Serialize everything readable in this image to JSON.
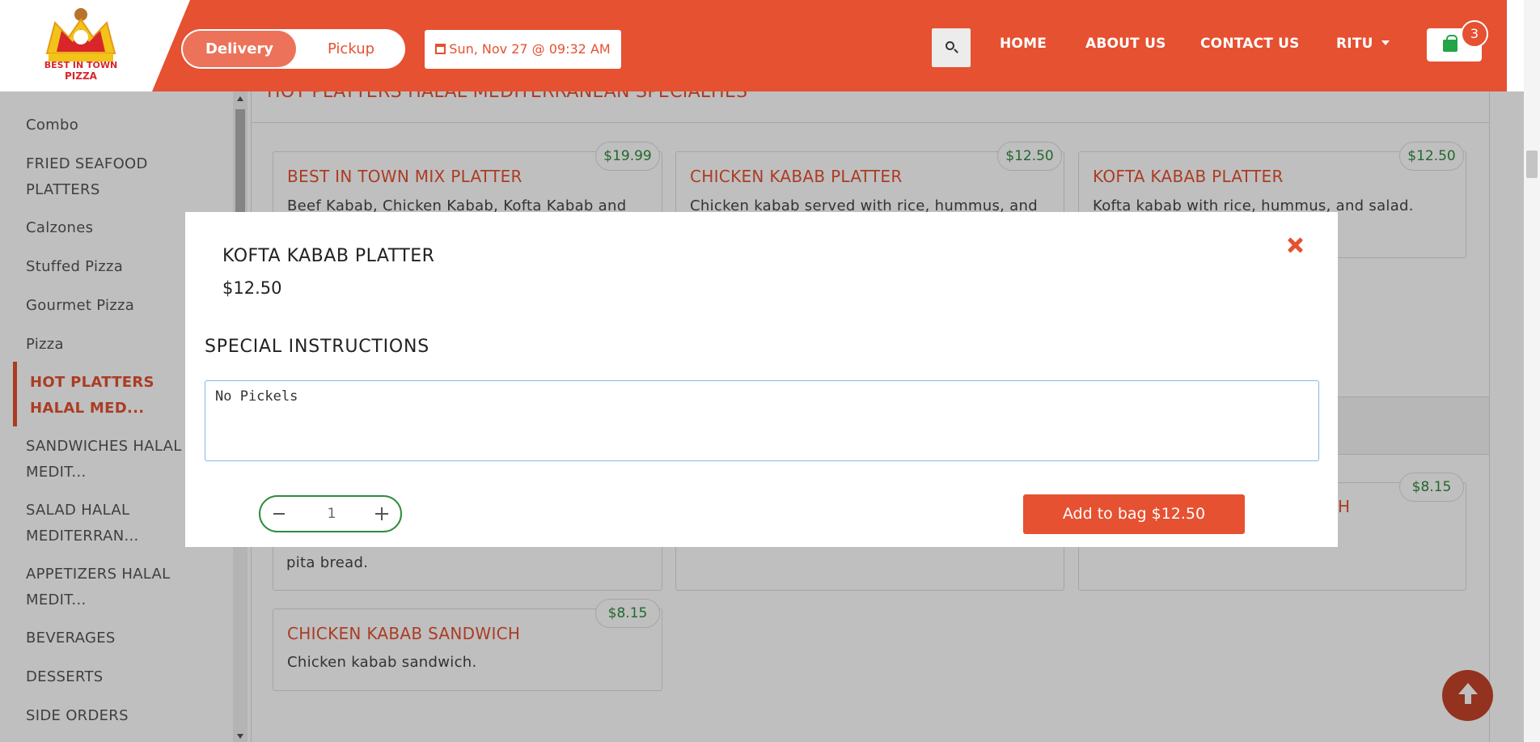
{
  "header": {
    "logo_text": "BEST IN TOWN PIZZA",
    "order_mode": {
      "active": "Delivery",
      "inactive": "Pickup"
    },
    "datetime": "Sun, Nov 27 @ 09:32 AM",
    "nav": [
      {
        "label": "HOME"
      },
      {
        "label": "ABOUT US"
      },
      {
        "label": "CONTACT US"
      },
      {
        "label": "RITU"
      }
    ],
    "cart_count": "3"
  },
  "sidebar": {
    "items": [
      {
        "label": "Combo"
      },
      {
        "label": "FRIED SEAFOOD PLATTERS"
      },
      {
        "label": "Calzones"
      },
      {
        "label": "Stuffed Pizza"
      },
      {
        "label": "Gourmet Pizza"
      },
      {
        "label": "Pizza"
      },
      {
        "label": "HOT PLATTERS HALAL MED..."
      },
      {
        "label": "SANDWICHES HALAL MEDIT..."
      },
      {
        "label": "SALAD HALAL MEDITERRAN..."
      },
      {
        "label": "APPETIZERS HALAL MEDIT..."
      },
      {
        "label": "BEVERAGES"
      },
      {
        "label": "DESSERTS"
      },
      {
        "label": "SIDE ORDERS"
      }
    ],
    "active_index": 6
  },
  "main": {
    "section_title": "HOT PLATTERS HALAL MEDITERRANEAN SPECIALTIES",
    "cards": [
      {
        "name": "BEST IN TOWN MIX PLATTER",
        "desc": "Beef Kabab, Chicken Kabab, Kofta Kabab and",
        "price": "$19.99"
      },
      {
        "name": "CHICKEN KABAB PLATTER",
        "desc": "Chicken kabab served with rice, hummus, and",
        "price": "$12.50"
      },
      {
        "name": "KOFTA KABAB PLATTER",
        "desc": "Kofta kabab with rice, hummus, and salad.",
        "price": "$12.50"
      },
      {
        "name": "CHICKEN KABAB SANDWICH",
        "desc": "Chicken kabab sandwich.",
        "price": "$8.15"
      }
    ],
    "partial": {
      "price": "$8.15",
      "name_fragment": "H",
      "desc_fragment": "pita bread."
    }
  },
  "modal": {
    "title": "KOFTA KABAB PLATTER",
    "price": "$12.50",
    "instructions_label": "SPECIAL INSTRUCTIONS",
    "instructions_value": "No Pickels",
    "quantity": "1",
    "add_button": "Add to bag $12.50"
  },
  "colors": {
    "brand": "#e55131",
    "price_green": "#2e8b3e",
    "cart_green": "#22a447"
  }
}
